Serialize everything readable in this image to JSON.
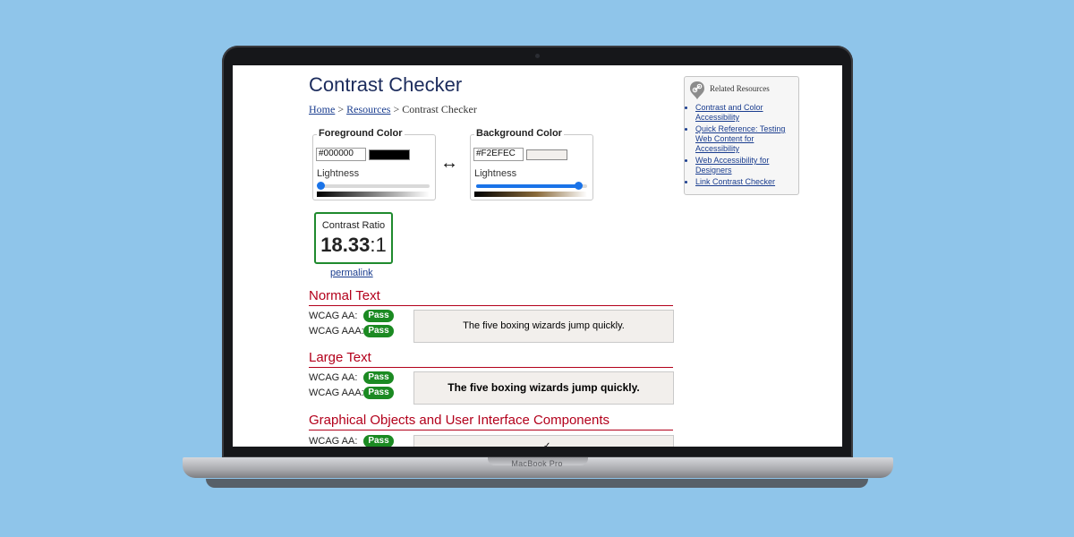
{
  "page": {
    "title": "Contrast Checker",
    "breadcrumb": {
      "home": "Home",
      "resources": "Resources",
      "separator": ">",
      "current": "Contrast Checker"
    }
  },
  "foreground": {
    "legend": "Foreground Color",
    "hex": "#000000",
    "swatch_color": "#000000",
    "lightness_label": "Lightness",
    "lightness_value": 0.02
  },
  "background": {
    "legend": "Background Color",
    "hex": "#F2EFEC",
    "swatch_color": "#F2EFEC",
    "lightness_label": "Lightness",
    "lightness_value": 0.92
  },
  "swap_icon": "↔",
  "ratio": {
    "label": "Contrast Ratio",
    "value_bold": "18.33",
    "value_suffix": ":1",
    "permalink": "permalink"
  },
  "sections": {
    "normal": {
      "heading": "Normal Text",
      "aa_label": "WCAG AA:",
      "aa_result": "Pass",
      "aaa_label": "WCAG AAA:",
      "aaa_result": "Pass",
      "sample": "The five boxing wizards jump quickly."
    },
    "large": {
      "heading": "Large Text",
      "aa_label": "WCAG AA:",
      "aa_result": "Pass",
      "aaa_label": "WCAG AAA:",
      "aaa_result": "Pass",
      "sample": "The five boxing wizards jump quickly."
    },
    "graphical": {
      "heading": "Graphical Objects and User Interface Components",
      "aa_label": "WCAG AA:",
      "aa_result": "Pass",
      "mark": "✓"
    }
  },
  "related": {
    "title": "Related Resources",
    "links": [
      "Contrast and Color Accessibility",
      "Quick Reference: Testing Web Content for Accessibility",
      "Web Accessibility for Designers",
      "Link Contrast Checker"
    ]
  },
  "device": {
    "brand": "MacBook Pro"
  },
  "colors": {
    "pass_green": "#1b8a22",
    "heading_red": "#b3001b",
    "link_blue": "#1a3d8f",
    "slider_blue": "#1a73e8",
    "backdrop": "#8fc5ea"
  }
}
